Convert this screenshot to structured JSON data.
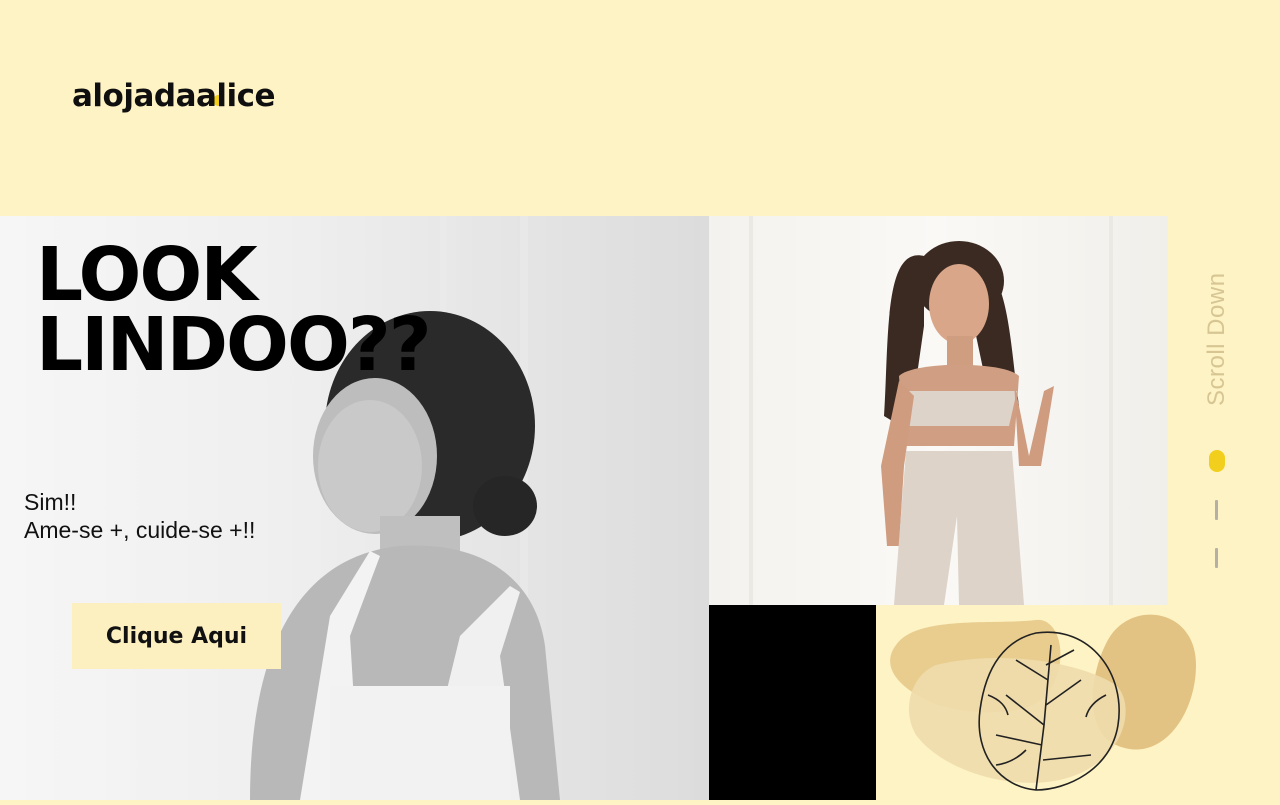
{
  "brand": {
    "logo_text": "alojadaalice"
  },
  "hero": {
    "headline": "LOOK\nLINDOO??",
    "subtext": "Sim!!\nAme-se +, cuide-se +!!",
    "cta_label": "Clique Aqui"
  },
  "scroll_indicator": {
    "label": "Scroll Down"
  },
  "colors": {
    "background": "#fef3c4",
    "accent_yellow": "#f2cf1c",
    "cta_background": "#fcefc0",
    "block_black": "#000000",
    "shape_tan": "#e7c98c"
  },
  "icons": {
    "monstera": "monstera-leaf-icon"
  }
}
